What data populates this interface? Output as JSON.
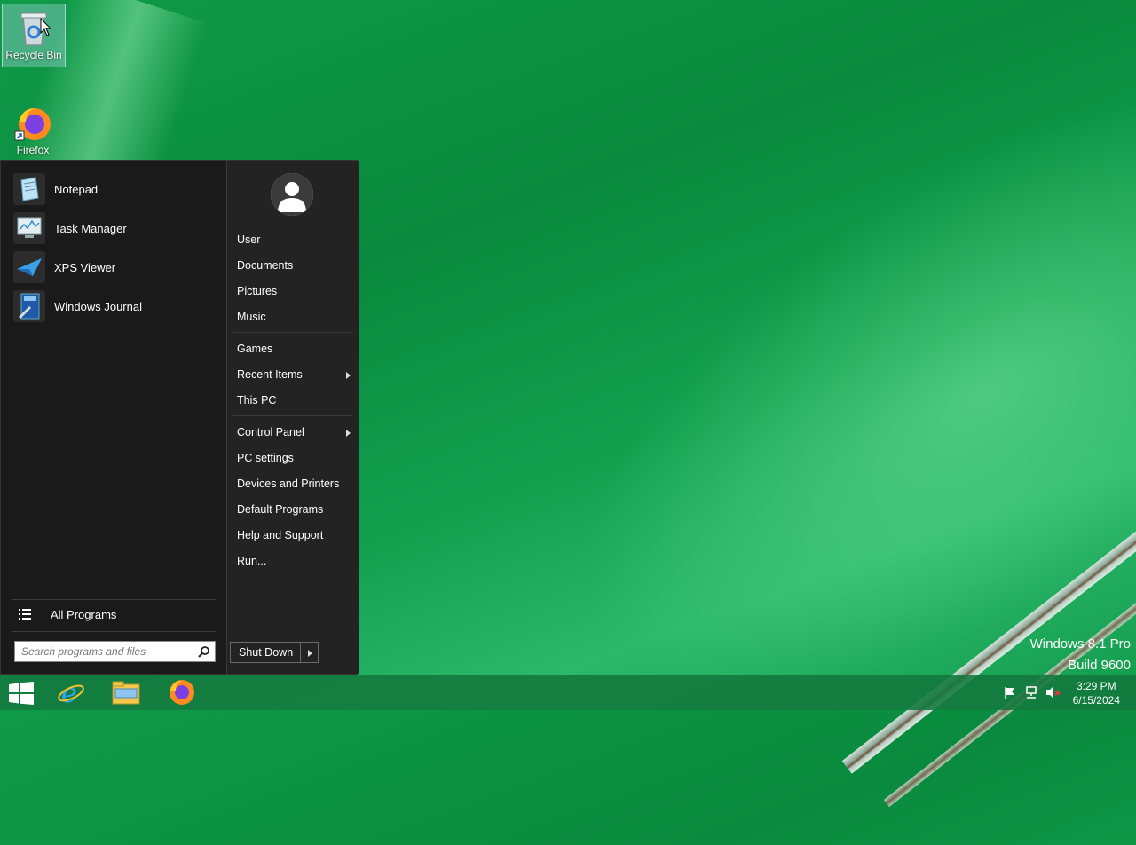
{
  "desktop": {
    "icons": [
      {
        "label": "Recycle Bin",
        "icon": "recycle-bin-icon"
      },
      {
        "label": "Firefox",
        "icon": "firefox-icon"
      }
    ],
    "watermark": {
      "line1": "Windows 8.1 Pro",
      "line2": "Build 9600"
    }
  },
  "start_menu": {
    "programs": [
      {
        "label": "Notepad",
        "icon": "notepad-icon"
      },
      {
        "label": "Task Manager",
        "icon": "task-manager-icon"
      },
      {
        "label": "XPS Viewer",
        "icon": "xps-viewer-icon"
      },
      {
        "label": "Windows Journal",
        "icon": "windows-journal-icon"
      }
    ],
    "all_programs": "All Programs",
    "search_placeholder": "Search programs and files",
    "right": {
      "group1": [
        "User",
        "Documents",
        "Pictures",
        "Music"
      ],
      "group2": [
        "Games",
        "Recent Items",
        "This PC"
      ],
      "group3": [
        "Control Panel",
        "PC settings",
        "Devices and Printers",
        "Default Programs",
        "Help and Support",
        "Run..."
      ]
    },
    "shutdown_label": "Shut Down"
  },
  "taskbar": {
    "pinned": [
      "start-button",
      "internet-explorer-icon",
      "file-explorer-icon",
      "firefox-icon"
    ],
    "clock": {
      "time": "3:29 PM",
      "date": "6/15/2024"
    },
    "tray_icons": [
      "action-center-flag-icon",
      "network-icon",
      "volume-muted-icon"
    ]
  },
  "colors": {
    "menu_bg": "#1d1d1d",
    "taskbar": "#12783c",
    "accent": "#0f9a48"
  }
}
